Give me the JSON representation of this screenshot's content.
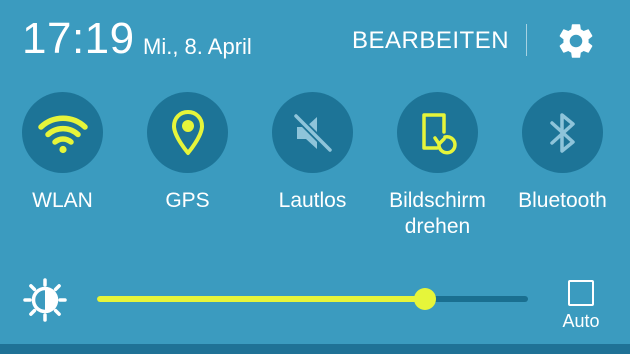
{
  "header": {
    "time": "17:19",
    "date": "Mi., 8. April",
    "edit_label": "BEARBEITEN",
    "settings_icon": "gear-icon"
  },
  "quick_tiles": [
    {
      "label": "WLAN",
      "icon": "wifi-icon",
      "active": true
    },
    {
      "label": "GPS",
      "icon": "location-pin-icon",
      "active": true
    },
    {
      "label": "Lautlos",
      "icon": "mute-icon",
      "active": false
    },
    {
      "label": "Bildschirm drehen",
      "line1": "Bildschirm",
      "line2": "drehen",
      "icon": "screen-rotation-icon",
      "active": true
    },
    {
      "label": "Bluetooth",
      "icon": "bluetooth-icon",
      "active": false
    }
  ],
  "brightness": {
    "icon": "brightness-sun-icon",
    "level": 0.76,
    "auto_label": "Auto",
    "auto_checked": false
  },
  "colors": {
    "background": "#3b9bbf",
    "tile_circle": "#1d7497",
    "active_accent": "#e6f53a",
    "inactive_icon": "#8ec4da",
    "slider_track": "#1a6f90",
    "text": "#ffffff"
  }
}
